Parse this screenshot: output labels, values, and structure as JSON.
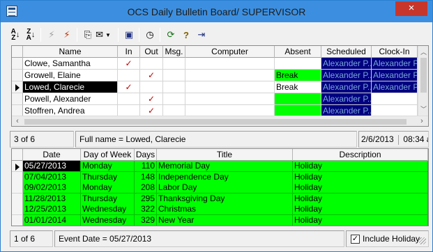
{
  "window": {
    "title": "OCS Daily Bulletin Board/ SUPERVISOR",
    "close_glyph": "×"
  },
  "toolbar": {
    "icons": [
      "sort-ascending-icon",
      "sort-descending-icon",
      "filter-icon",
      "remove-filter-icon",
      "copy-icon",
      "mail-dropdown-icon",
      "monitor-icon",
      "clock-icon",
      "refresh-icon",
      "help-icon",
      "exit-icon"
    ]
  },
  "employees": {
    "columns": [
      "Name",
      "In",
      "Out",
      "Msg.",
      "Computer",
      "Absent",
      "Scheduled",
      "Clock-In"
    ],
    "rows": [
      {
        "name": "Clowe, Samantha",
        "in": "✓",
        "out": "",
        "msg": "",
        "computer": "",
        "absent": "",
        "scheduled": "Alexander P...",
        "clockin": "Alexander P...",
        "absent_color": "white",
        "current": false
      },
      {
        "name": "Growell, Elaine",
        "in": "",
        "out": "✓",
        "msg": "",
        "computer": "",
        "absent": "Break",
        "scheduled": "Alexander P...",
        "clockin": "Alexander P...",
        "absent_color": "green",
        "current": false
      },
      {
        "name": "Lowed, Clarecie",
        "in": "✓",
        "out": "",
        "msg": "",
        "computer": "",
        "absent": "Break",
        "scheduled": "Alexander P...",
        "clockin": "Alexander P...",
        "absent_color": "white",
        "current": true
      },
      {
        "name": "Powell, Alexander",
        "in": "",
        "out": "✓",
        "msg": "",
        "computer": "",
        "absent": "",
        "scheduled": "Alexander P...",
        "clockin": "",
        "absent_color": "green",
        "current": false
      },
      {
        "name": "Stoffren, Andrea",
        "in": "",
        "out": "✓",
        "msg": "",
        "computer": "",
        "absent": "",
        "scheduled": "Alexander P...",
        "clockin": "",
        "absent_color": "green",
        "current": false
      }
    ]
  },
  "status1": {
    "record": "3 of 6",
    "fullname": "Full name = Lowed, Clarecie",
    "date": "2/6/2013",
    "time": "08:34 am"
  },
  "events": {
    "columns": [
      "Date",
      "Day of Week",
      "Days",
      "Title",
      "Description"
    ],
    "rows": [
      {
        "date": "05/27/2013",
        "dow": "Monday",
        "days": "110",
        "title": "Memorial Day",
        "desc": "Holiday",
        "current": true
      },
      {
        "date": "07/04/2013",
        "dow": "Thursday",
        "days": "148",
        "title": "Independence Day",
        "desc": "Holiday",
        "current": false
      },
      {
        "date": "09/02/2013",
        "dow": "Monday",
        "days": "208",
        "title": "Labor Day",
        "desc": "Holiday",
        "current": false
      },
      {
        "date": "11/28/2013",
        "dow": "Thursday",
        "days": "295",
        "title": "Thanksgiving Day",
        "desc": "Holiday",
        "current": false
      },
      {
        "date": "12/25/2013",
        "dow": "Wednesday",
        "days": "322",
        "title": "Christmas",
        "desc": "Holiday",
        "current": false
      },
      {
        "date": "01/01/2014",
        "dow": "Wednesday",
        "days": "329",
        "title": "New Year",
        "desc": "Holiday",
        "current": false
      }
    ]
  },
  "status2": {
    "record": "1 of 6",
    "event_date": "Event Date = 05/27/2013",
    "include_holiday_label": "Include Holiday",
    "include_holiday_checked": "✓"
  }
}
